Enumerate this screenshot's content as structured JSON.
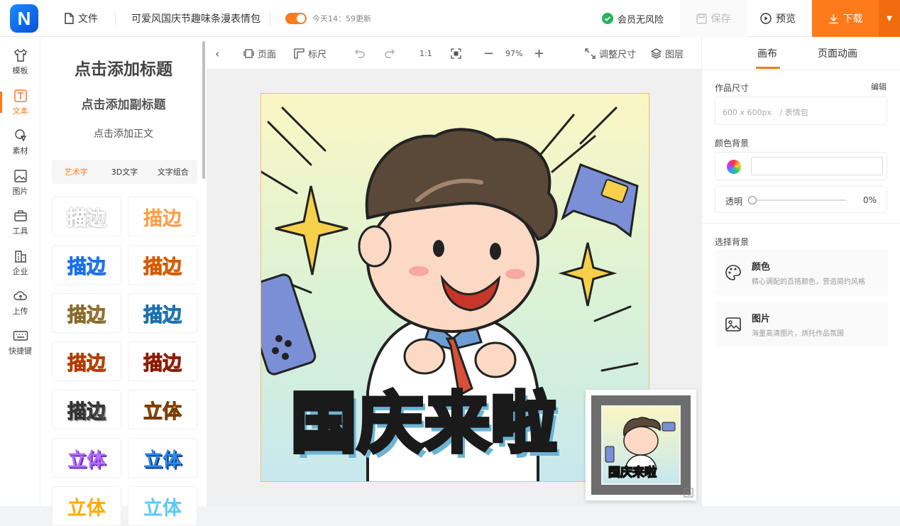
{
  "topbar": {
    "logo_letter": "N",
    "file_label": "文件",
    "doc_title": "可爱风国庆节趣味条漫表情包",
    "update_text": "今天14：59更新",
    "member_text": "会员无风险",
    "save_label": "保存",
    "preview_label": "预览",
    "download_label": "下载"
  },
  "leftnav": {
    "items": [
      {
        "label": "模板"
      },
      {
        "label": "文本"
      },
      {
        "label": "素材"
      },
      {
        "label": "图片"
      },
      {
        "label": "工具"
      },
      {
        "label": "企业"
      },
      {
        "label": "上传"
      },
      {
        "label": "快捷键"
      }
    ]
  },
  "textpanel": {
    "add_title": "点击添加标题",
    "add_subtitle": "点击添加副标题",
    "add_body": "点击添加正文",
    "tabs": [
      "艺术字",
      "3D文字",
      "文字组合"
    ],
    "samples": [
      "描边",
      "描边",
      "描边",
      "描边",
      "描边",
      "描边",
      "描边",
      "描边",
      "描边",
      "立体",
      "立体",
      "立体",
      "立体",
      "立体"
    ]
  },
  "toolbar": {
    "page_label": "页面",
    "ruler_label": "标尺",
    "ratio_label": "1:1",
    "zoom_value": "97%",
    "resize_label": "调整尺寸",
    "layers_label": "图层"
  },
  "canvas": {
    "headline": "国庆来啦",
    "mini_headline": "国庆来啦"
  },
  "rightpanel": {
    "tab_canvas": "画布",
    "tab_animation": "页面动画",
    "size_label": "作品尺寸",
    "edit_label": "编辑",
    "size_value": "600 x 600px",
    "size_type": "/ 表情包",
    "bg_color_label": "颜色背景",
    "opacity_label": "透明",
    "opacity_value": "0%",
    "choose_bg_label": "选择背景",
    "color_card_title": "颜色",
    "color_card_desc": "精心调配的百搭颜色，营造简约风格",
    "image_card_title": "图片",
    "image_card_desc": "海量高清图片，烘托作品氛围"
  },
  "colors": {
    "accent": "#ff7a1a",
    "logo": "#1a6fe8",
    "member_green": "#27b35a"
  }
}
